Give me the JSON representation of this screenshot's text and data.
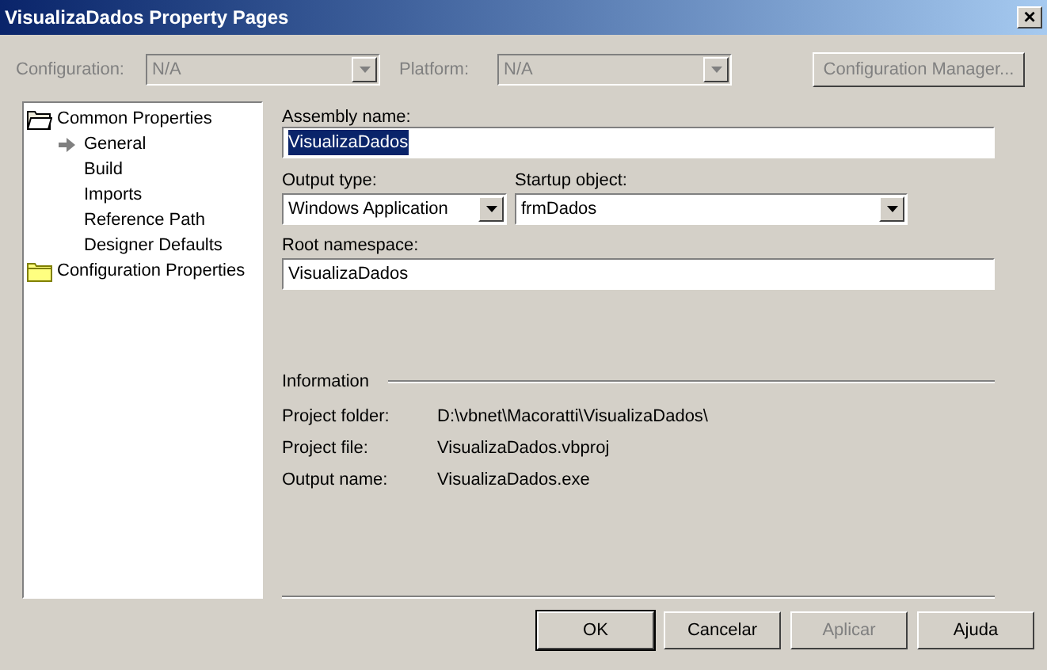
{
  "window": {
    "title": "VisualizaDados Property Pages",
    "close": "×"
  },
  "toolbar": {
    "configuration": {
      "label": "Configuration:",
      "value": "N/A",
      "disabled": true
    },
    "platform": {
      "label": "Platform:",
      "value": "N/A",
      "disabled": true
    },
    "manager_button": {
      "label": "Configuration Manager...",
      "disabled": true
    }
  },
  "tree": [
    {
      "label": "Common Properties",
      "expanded": true,
      "selected": false,
      "children": [
        {
          "label": "General",
          "selected": true
        },
        {
          "label": "Build",
          "selected": false
        },
        {
          "label": "Imports",
          "selected": false
        },
        {
          "label": "Reference Path",
          "selected": false
        },
        {
          "label": "Designer Defaults",
          "selected": false
        }
      ]
    },
    {
      "label": "Configuration Properties",
      "expanded": false,
      "selected": false
    }
  ],
  "form": {
    "assembly_name": {
      "label": "Assembly name:",
      "value": "VisualizaDados",
      "text_selected": true
    },
    "output_type": {
      "label": "Output type:",
      "value": "Windows Application"
    },
    "startup_object": {
      "label": "Startup object:",
      "value": "frmDados"
    },
    "root_namespace": {
      "label": "Root namespace:",
      "value": "VisualizaDados"
    }
  },
  "information": {
    "heading": "Information",
    "rows": [
      {
        "label": "Project folder:",
        "value": "D:\\vbnet\\Macoratti\\VisualizaDados\\"
      },
      {
        "label": "Project file:",
        "value": "VisualizaDados.vbproj"
      },
      {
        "label": "Output name:",
        "value": "VisualizaDados.exe"
      }
    ]
  },
  "buttons": [
    {
      "label": "OK",
      "default": true,
      "disabled": false
    },
    {
      "label": "Cancelar",
      "default": false,
      "disabled": false
    },
    {
      "label": "Aplicar",
      "default": false,
      "disabled": true
    },
    {
      "label": "Ajuda",
      "default": false,
      "disabled": false
    }
  ]
}
